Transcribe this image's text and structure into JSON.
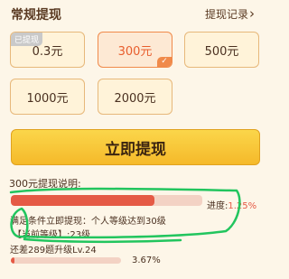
{
  "header": {
    "title": "常规提现",
    "record_link": "提现记录",
    "record_chevron": "›"
  },
  "options": [
    {
      "label": "0.3元",
      "tag": "已提现"
    },
    {
      "label": "300元",
      "check": "✓"
    },
    {
      "label": "500元"
    },
    {
      "label": "1000元"
    },
    {
      "label": "2000元"
    }
  ],
  "selected_option": "300元",
  "withdraw_button": "立即提现",
  "description": {
    "title": "300元提现说明:",
    "progress_label": "进度:",
    "progress_percent": "1.25%",
    "progress_fraction": 0.75,
    "condition": "满足条件立即提现：个人等级达到30级",
    "current_level": "【当前等级】:23级",
    "remaining": "还差289题升级Lv.24",
    "level_progress_percent": "3.67%",
    "level_progress_fraction": 0.0367
  },
  "colors": {
    "accent": "#f08a4a",
    "button": "#f5c33a",
    "progress": "#e55a45",
    "scribble": "#22c55e"
  }
}
